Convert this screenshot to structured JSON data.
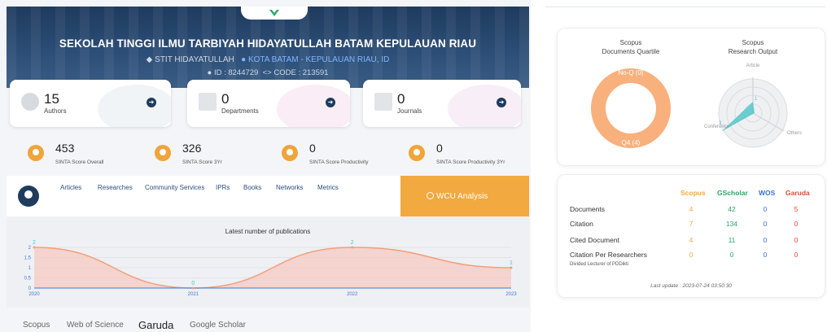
{
  "profile": {
    "name": "SEKOLAH TINGGI ILMU TARBIYAH HIDAYATULLAH BATAM KEPULAUAN RIAU",
    "short_name": "STIT HIDAYATULLAH",
    "location": "KOTA BATAM - KEPULAUAN RIAU, ID",
    "id_text": "ID : 8244729",
    "code_text": "CODE : 213591"
  },
  "stats": [
    {
      "value": "15",
      "label": "Authors"
    },
    {
      "value": "0",
      "label": "Departments"
    },
    {
      "value": "0",
      "label": "Journals"
    }
  ],
  "scores": [
    {
      "value": "453",
      "label": "SINTA Score Overall"
    },
    {
      "value": "326",
      "label": "SINTA Score 3Yr"
    },
    {
      "value": "0",
      "label": "SINTA Score Productivity"
    },
    {
      "value": "0",
      "label": "SINTA Score Productivity 3Yr"
    }
  ],
  "tabs": [
    "Articles",
    "Researches",
    "Community Services",
    "IPRs",
    "Books",
    "Networks",
    "Metrics"
  ],
  "wcu_label": "WCU Analysis",
  "publications_chart": {
    "title": "Latest number of publications"
  },
  "chart_data": {
    "type": "area",
    "title": "Latest number of publications",
    "x": [
      "2020",
      "2021",
      "2022",
      "2023"
    ],
    "values": [
      2,
      0,
      2,
      1
    ],
    "yticks": [
      "2",
      "1.5",
      "1",
      "0.5",
      "0"
    ],
    "ylim": [
      0,
      2
    ],
    "colors": {
      "line": "#f0a07a",
      "fill": "#f7c9c1"
    }
  },
  "bottom_tabs": [
    "Scopus",
    "Web of Science",
    "Garuda",
    "Google Scholar"
  ],
  "bottom_tab_active": "Garuda",
  "quartile": {
    "title_line1": "Scopus",
    "title_line2": "Documents Quartile",
    "top_label": "No-Q (0)",
    "bottom_label": "Q4 (4)",
    "color": "#f8b07d"
  },
  "research_output": {
    "title_line1": "Scopus",
    "title_line2": "Research Output",
    "axis_top": "Article",
    "axis_left": "Conference",
    "axis_right": "Others",
    "value_top": "1",
    "value_left": "3",
    "color": "#52c7c9"
  },
  "metrics_table": {
    "headers": [
      "Scopus",
      "GScholar",
      "WOS",
      "Garuda"
    ],
    "rows": [
      {
        "label": "Documents",
        "values": [
          "4",
          "42",
          "0",
          "5"
        ]
      },
      {
        "label": "Citation",
        "values": [
          "7",
          "134",
          "0",
          "0"
        ]
      },
      {
        "label": "Cited Document",
        "values": [
          "4",
          "11",
          "0",
          "0"
        ]
      },
      {
        "label": "Citation Per Researchers",
        "values": [
          "0",
          "0",
          "0",
          "0"
        ]
      }
    ],
    "note": "Divided Lecturer of PDDikti",
    "last_update": "Last update : 2023-07-24 03:50:30"
  }
}
